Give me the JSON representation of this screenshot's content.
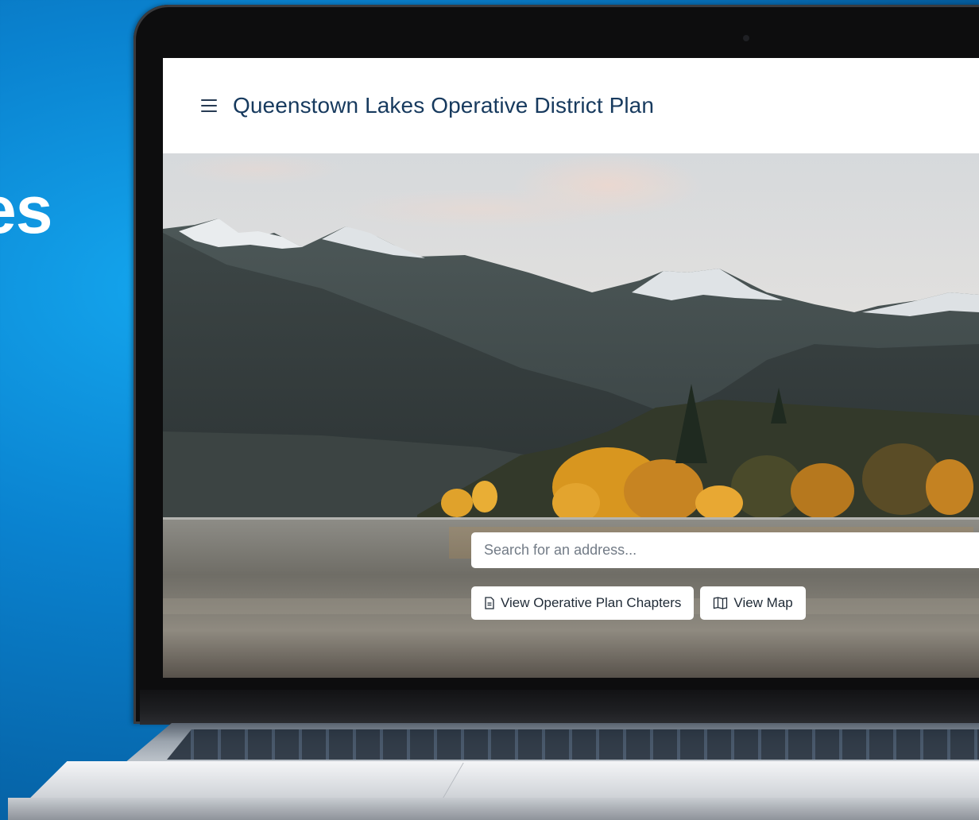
{
  "background": {
    "partial_word": "es",
    "accent_color": "#0a82cf"
  },
  "app": {
    "title": "Queenstown Lakes Operative District Plan",
    "menu_icon": "hamburger-menu-icon",
    "header_text_color": "#173a5e"
  },
  "hero": {
    "image_description_icon": "lake-mountain-landscape",
    "search": {
      "placeholder": "Search for an address...",
      "value": ""
    },
    "buttons": [
      {
        "label": "View Operative Plan Chapters",
        "icon": "document-icon"
      },
      {
        "label": "View Map",
        "icon": "map-icon"
      }
    ]
  }
}
